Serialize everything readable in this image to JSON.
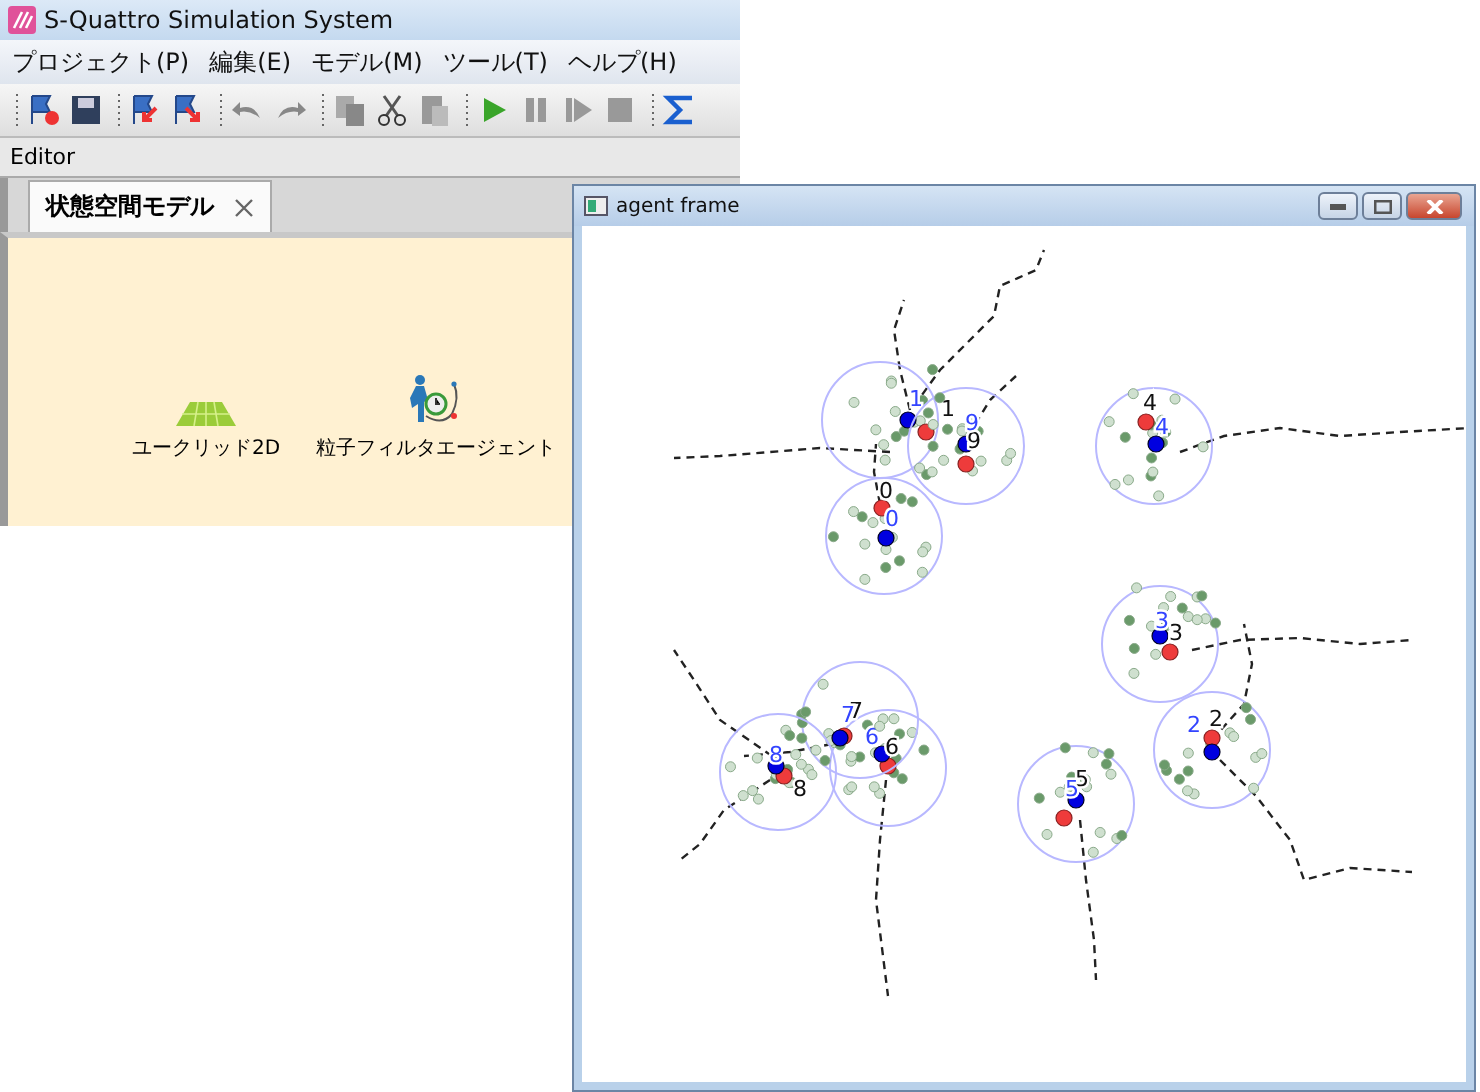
{
  "app_window": {
    "title": "S-Quattro Simulation System",
    "menu": [
      "プロジェクト(P)",
      "編集(E)",
      "モデル(M)",
      "ツール(T)",
      "ヘルプ(H)"
    ],
    "panel_title": "Editor",
    "tabs": [
      {
        "label": "状態空間モデル",
        "selected": true
      }
    ],
    "nodes": [
      {
        "label": "ユークリッド2D",
        "kind": "grid"
      },
      {
        "label": "粒子フィルタエージェント",
        "kind": "agent"
      }
    ]
  },
  "agent_frame": {
    "title": "agent frame",
    "agents": [
      {
        "label": "0",
        "estimate_label": "0"
      },
      {
        "label": "1",
        "estimate_label": "1"
      },
      {
        "label": "2",
        "estimate_label": "2"
      },
      {
        "label": "3",
        "estimate_label": "3"
      },
      {
        "label": "4",
        "estimate_label": "4"
      },
      {
        "label": "5",
        "estimate_label": "5"
      },
      {
        "label": "6",
        "estimate_label": "6"
      },
      {
        "label": "7",
        "estimate_label": "7"
      },
      {
        "label": "8",
        "estimate_label": "8"
      },
      {
        "label": "9",
        "estimate_label": "9"
      }
    ]
  }
}
